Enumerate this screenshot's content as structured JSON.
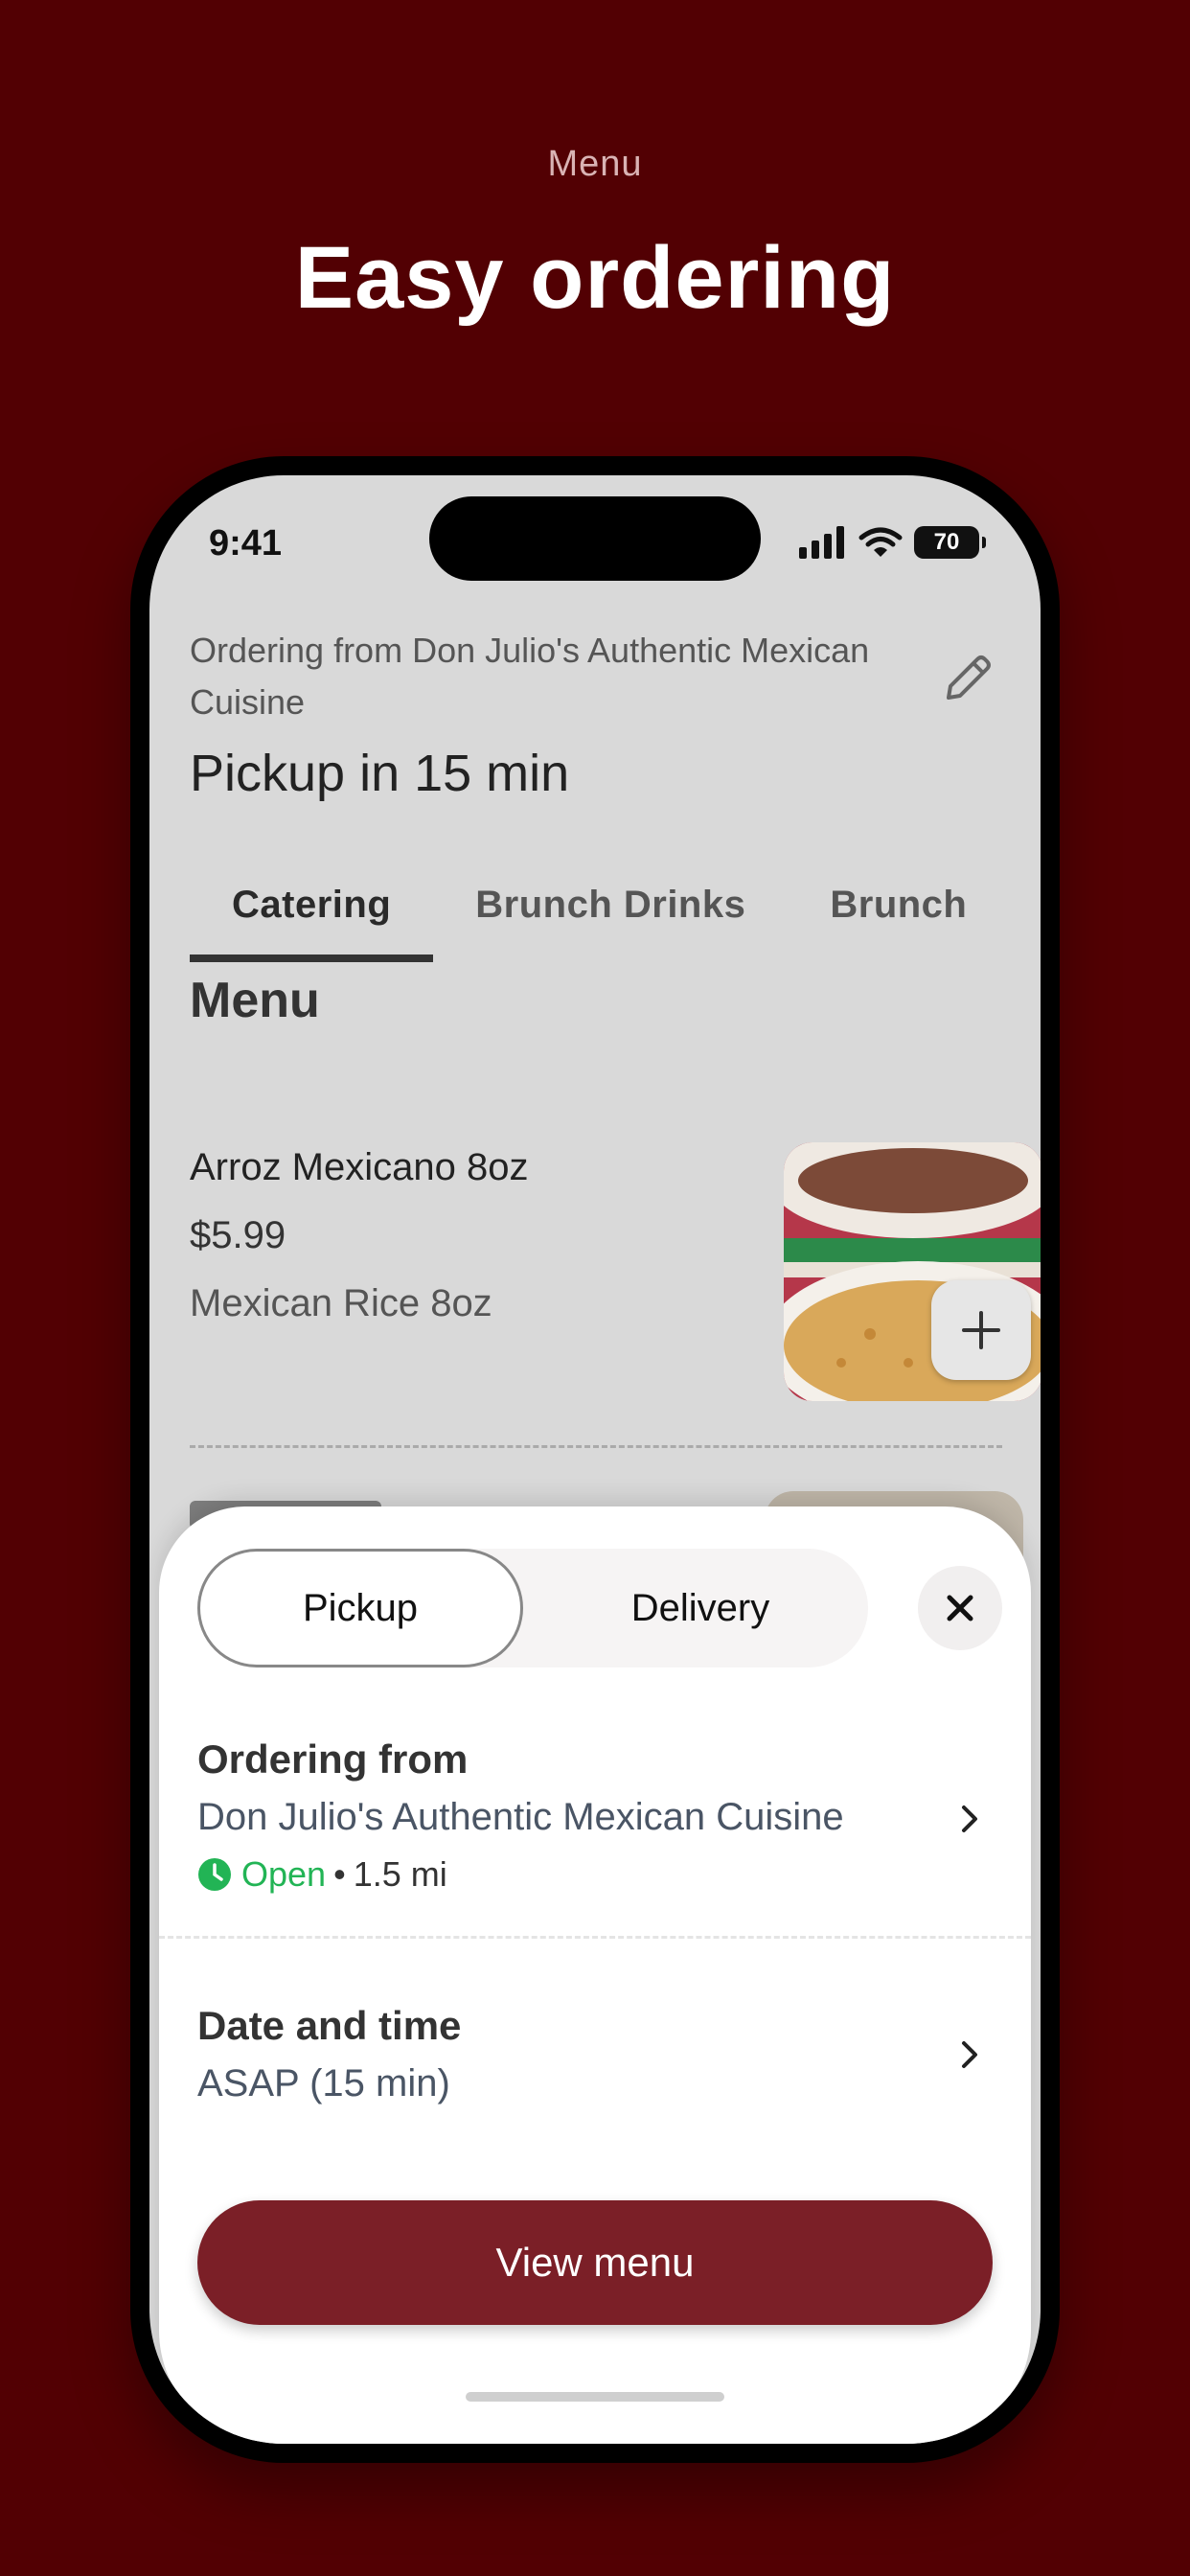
{
  "promo": {
    "label": "Menu",
    "title": "Easy ordering"
  },
  "status_bar": {
    "time": "9:41",
    "battery": "70",
    "icons": [
      "signal-icon",
      "wifi-icon",
      "battery-icon"
    ]
  },
  "header": {
    "ordering_from": "Ordering from Don Julio's Authentic Mexican Cuisine",
    "pickup_eta": "Pickup in 15 min",
    "edit_icon": "pencil-icon"
  },
  "tabs": [
    {
      "label": "Catering",
      "active": true
    },
    {
      "label": "Brunch Drinks",
      "active": false
    },
    {
      "label": "Brunch",
      "active": false
    }
  ],
  "menu": {
    "heading": "Menu",
    "items": [
      {
        "name": "Arroz Mexicano 8oz",
        "price": "$5.99",
        "description": "Mexican Rice 8oz"
      }
    ]
  },
  "sheet": {
    "segments": {
      "pickup": "Pickup",
      "delivery": "Delivery",
      "selected": "Pickup"
    },
    "ordering_from": {
      "title": "Ordering from",
      "restaurant": "Don Julio's Authentic Mexican Cuisine",
      "status": "Open",
      "separator": "•",
      "distance": "1.5 mi"
    },
    "date_time": {
      "title": "Date and time",
      "value": "ASAP (15 min)"
    },
    "primary_button": "View menu"
  },
  "colors": {
    "background": "#520003",
    "accent": "#7b1f27",
    "open_status": "#22b455"
  }
}
